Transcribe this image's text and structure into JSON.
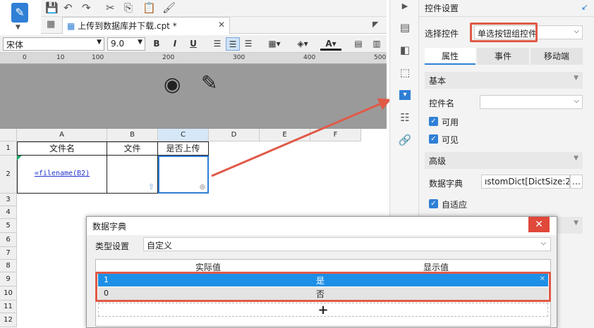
{
  "tab": {
    "title": "上传到数据库并下载.cpt *"
  },
  "format": {
    "font": "宋体",
    "size": "9.0"
  },
  "ruler": {
    "marks": [
      "0",
      "10",
      "100",
      "200",
      "300",
      "400",
      "500"
    ]
  },
  "grid": {
    "columns": [
      "A",
      "B",
      "C",
      "D",
      "E",
      "F"
    ],
    "rows": [
      "1",
      "2",
      "3",
      "4",
      "5",
      "6",
      "7",
      "8",
      "9",
      "10",
      "11",
      "12"
    ],
    "cells": {
      "a1": "文件名",
      "b1": "文件",
      "c1": "是否上传",
      "a2": "=filename(B2)"
    }
  },
  "panel": {
    "header": "控件设置",
    "select_label": "选择控件",
    "select_value": "单选按钮组控件",
    "tabs": [
      "属性",
      "事件",
      "移动端"
    ],
    "basic": "基本",
    "name_label": "控件名",
    "enabled": "可用",
    "visible": "可见",
    "advanced": "高级",
    "dict_label": "数据字典",
    "dict_value": "ıstomDict[DictSize:2]",
    "adaptive": "自适应"
  },
  "dialog": {
    "title": "数据字典",
    "type_label": "类型设置",
    "type_value": "自定义",
    "col_actual": "实际值",
    "col_display": "显示值",
    "rows": [
      {
        "actual": "1",
        "display": "是"
      },
      {
        "actual": "0",
        "display": "否"
      }
    ],
    "add": "+"
  }
}
